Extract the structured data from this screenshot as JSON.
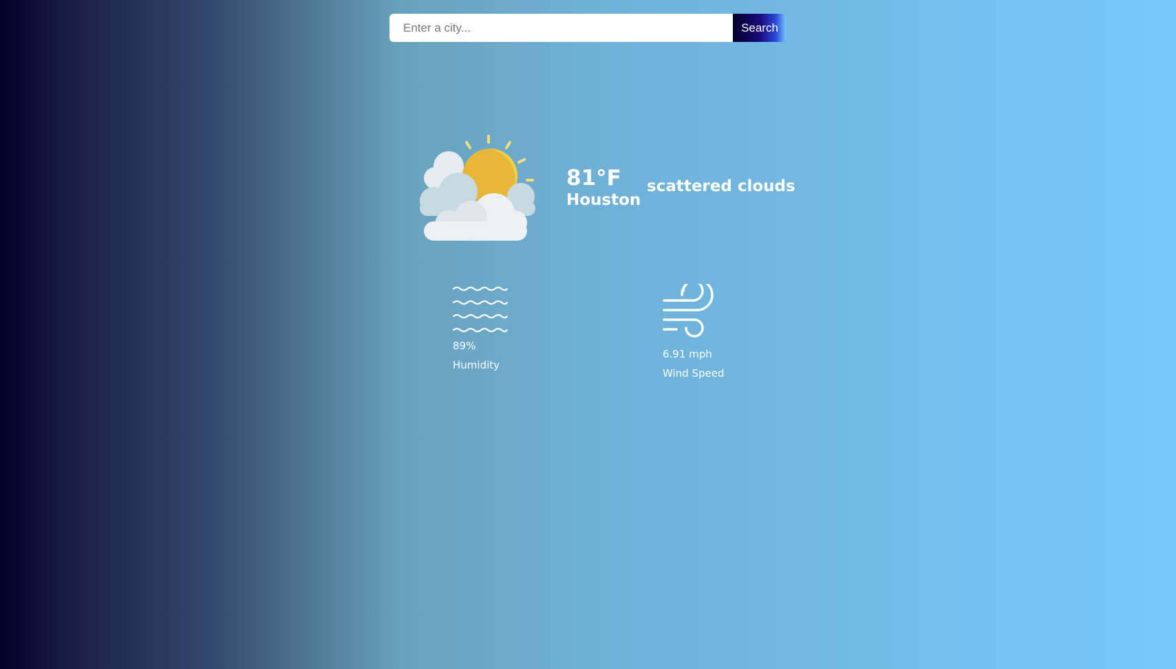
{
  "search": {
    "placeholder": "Enter a city...",
    "value": "",
    "button_label": "Search"
  },
  "weather": {
    "icon": "partly-cloudy-icon",
    "temperature": "81°F",
    "city": "Houston",
    "description": "scattered clouds"
  },
  "details": {
    "humidity": {
      "icon": "humidity-waves-icon",
      "value": "89%",
      "label": "Humidity"
    },
    "wind": {
      "icon": "wind-icon",
      "value": "6.91 mph",
      "label": "Wind Speed"
    }
  },
  "colors": {
    "background_left": "#04002a",
    "background_right": "#79c8fb",
    "search_button_start": "#04002a",
    "text": "#ffffff"
  }
}
